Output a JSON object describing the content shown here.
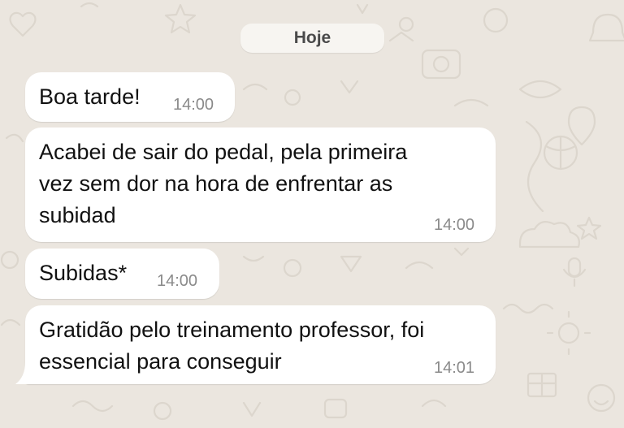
{
  "date_divider": "Hoje",
  "messages": [
    {
      "text": "Boa tarde!",
      "time": "14:00"
    },
    {
      "text": "Acabei de sair do pedal, pela primeira\nvez sem dor na hora de enfrentar as\nsubidad",
      "time": "14:00"
    },
    {
      "text": "Subidas*",
      "time": "14:00"
    },
    {
      "text": "Gratidão pelo treinamento professor, foi\nessencial para conseguir",
      "time": "14:01"
    }
  ],
  "colors": {
    "wallpaper": "#ebe6df",
    "bubble": "#ffffff",
    "timestamp": "#8a8a8a"
  }
}
